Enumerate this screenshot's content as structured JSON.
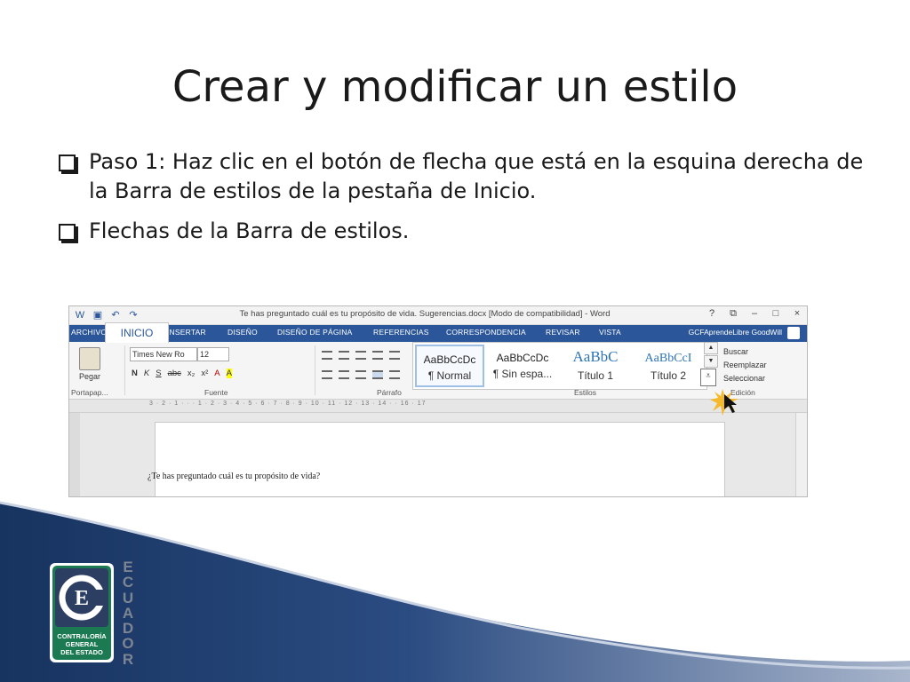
{
  "slide": {
    "title": "Crear  y modificar un estilo",
    "bullets": [
      "Paso 1: Haz clic en el botón de flecha que está en la esquina derecha de la Barra de estilos de la pestaña de Inicio.",
      " Flechas de la Barra de estilos."
    ]
  },
  "word": {
    "window_title": "Te has preguntado cuál es tu propósito de vida. Sugerencias.docx [Modo de compatibilidad] - Word",
    "window_controls": [
      "?",
      "⧉",
      "–",
      "□",
      "×"
    ],
    "tabs": [
      "ARCHIVO",
      "INSERTAR",
      "DISEÑO",
      "DISEÑO DE PÁGINA",
      "REFERENCIAS",
      "CORRESPONDENCIA",
      "REVISAR",
      "VISTA"
    ],
    "active_tab": "INICIO",
    "user": "GCFAprendeLibre GoodWill",
    "ribbon": {
      "paste_label": "Pegar",
      "font_name": "Times New Ro",
      "font_size": "12",
      "format_row": [
        "N",
        "K",
        "S",
        "abc",
        "x₂",
        "x²",
        "A",
        "A"
      ],
      "styles": [
        {
          "sample": "AaBbCcDc",
          "name": "¶ Normal"
        },
        {
          "sample": "AaBbCcDc",
          "name": "¶ Sin espa..."
        },
        {
          "sample": "AaBbC",
          "name": "Título 1"
        },
        {
          "sample": "AaBbCcI",
          "name": "Título 2"
        }
      ],
      "editing": [
        "Buscar",
        "Reemplazar",
        "Seleccionar"
      ],
      "groups": [
        "Portapap...",
        "Fuente",
        "Párrafo",
        "Estilos",
        "Edición"
      ]
    },
    "ruler_numbers": "3 · 2 · 1 · · · 1 · 2 · 3 · 4 · 5 · 6 · 7 · 8 · 9 · 10 · 11 · 12 · 13 · 14 · · 16 · 17",
    "document_text": "¿Te has preguntado cuál es tu propósito de vida?"
  },
  "branding": {
    "logo_lines": [
      "CONTRALORÍA",
      "GENERAL",
      "DEL ESTADO"
    ],
    "vertical_word": [
      "E",
      "C",
      "U",
      "A",
      "D",
      "O",
      "R"
    ],
    "colors": {
      "primary_blue": "#1f3f7a",
      "accent_blue": "#2b579a",
      "grey": "#7d8593"
    }
  }
}
